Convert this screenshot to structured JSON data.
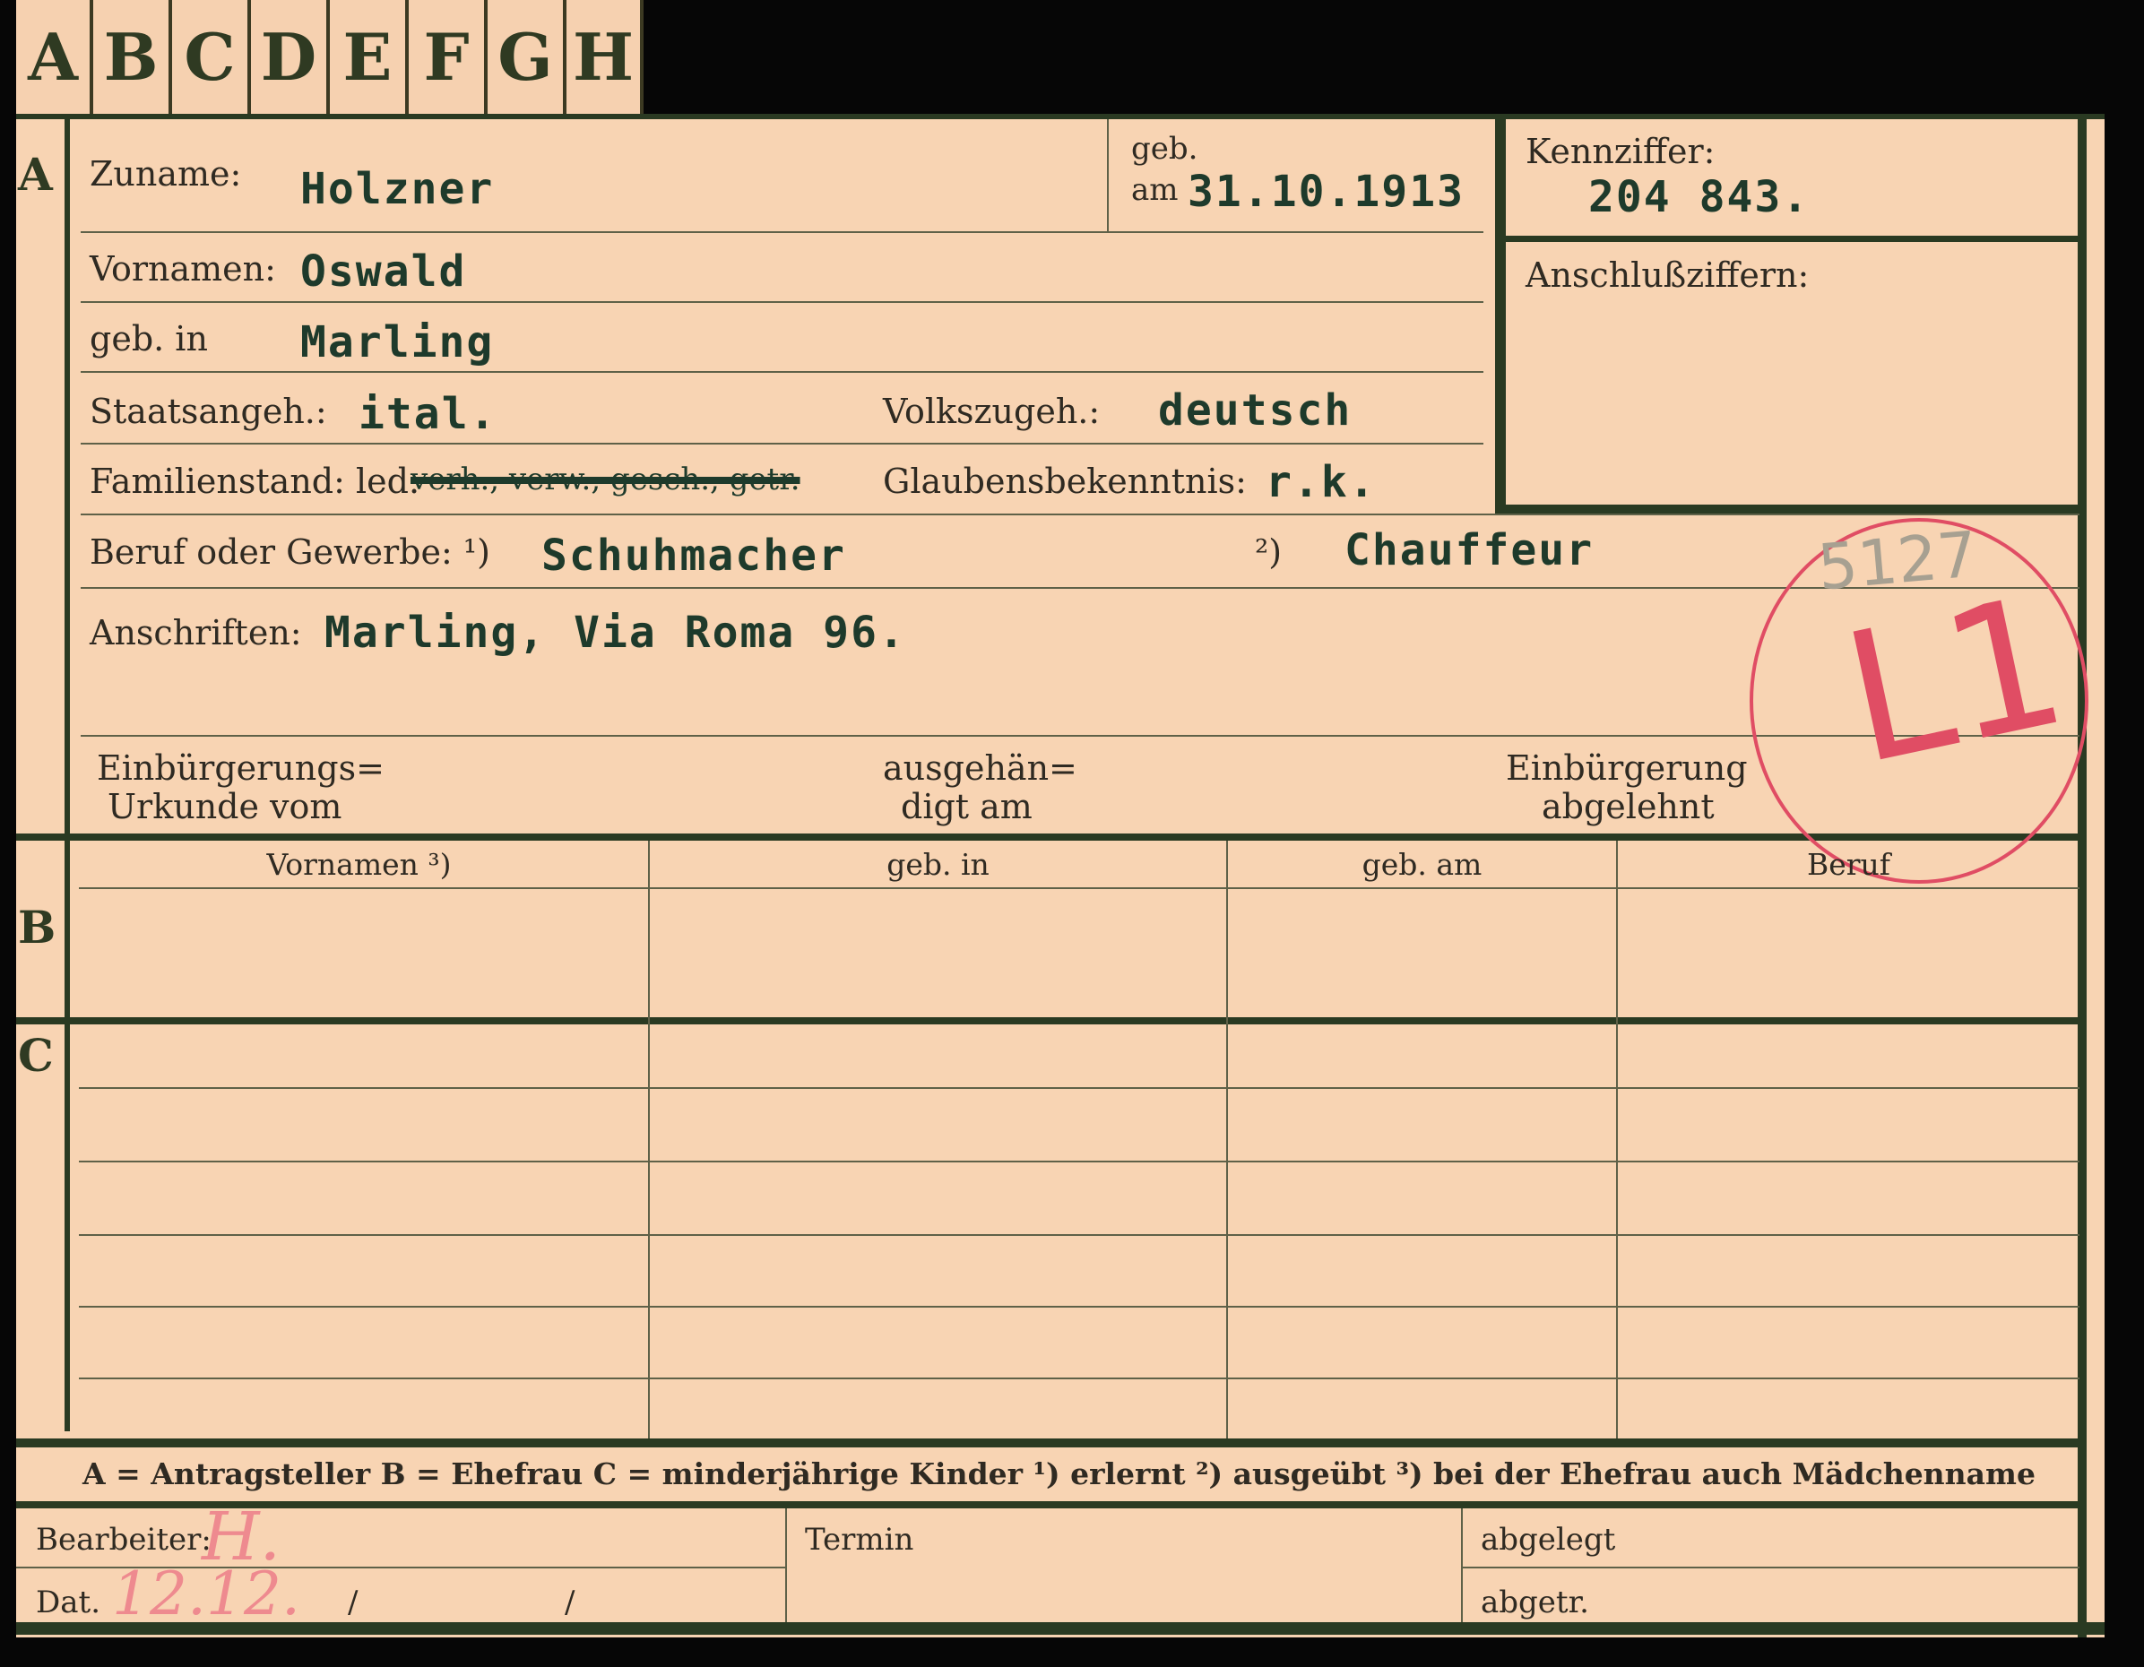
{
  "tabs": [
    "A",
    "B",
    "C",
    "D",
    "E",
    "F",
    "G",
    "H"
  ],
  "section_letters": {
    "a": "A",
    "b": "B",
    "c": "C"
  },
  "fields": {
    "zuname_label": "Zuname:",
    "zuname_value": "Holzner",
    "geb_label_top": "geb.",
    "geb_label_am": "am",
    "geb_value": "31.10.1913",
    "kennziffer_label": "Kennziffer:",
    "kennziffer_value": "204 843.",
    "anschluss_label": "Anschlußziffern:",
    "vornamen_label": "Vornamen:",
    "vornamen_value": "Oswald",
    "gebin_label": "geb. in",
    "gebin_value": "Marling",
    "staat_label": "Staatsangeh.:",
    "staat_value": "ital.",
    "volk_label": "Volkszugeh.:",
    "volk_value": "deutsch",
    "familien_label": "Familienstand: led.",
    "familien_crossed": "verh., verw., gesch., getr.",
    "glauben_label": "Glaubensbekenntnis:",
    "glauben_value": "r.k.",
    "beruf_label": "Beruf oder Gewerbe: ¹)",
    "beruf_value1": "Schuhmacher",
    "beruf_mark2": "²)",
    "beruf_value2": "Chauffeur",
    "anschrift_label": "Anschriften:",
    "anschrift_value": "Marling, Via Roma 96.",
    "einb_urkunde_1": "Einbürgerungs=",
    "einb_urkunde_2": "Urkunde vom",
    "ausgeh_1": "ausgehän=",
    "ausgeh_2": "digt am",
    "abgelehnt_1": "Einbürgerung",
    "abgelehnt_2": "abgelehnt"
  },
  "stamp": {
    "number": "5127",
    "code": "L1"
  },
  "table_headers": [
    "Vornamen ³)",
    "geb. in",
    "geb. am",
    "Beruf"
  ],
  "legend": "A = Antragsteller   B = Ehefrau   C = minderjährige Kinder   ¹) erlernt   ²) ausgeübt   ³) bei der Ehefrau auch Mädchenname",
  "footer": {
    "bearbeiter_label": "Bearbeiter:",
    "bearbeiter_sig": "H.",
    "termin_label": "Termin",
    "abgelegt_label": "abgelegt",
    "dat_label": "Dat.",
    "dat_value": "12.12.",
    "dat_sep1": "/",
    "dat_sep2": "/",
    "abgetr_label": "abgetr."
  },
  "colors": {
    "paper": "#f8d4b3",
    "ink": "#1e3a2b",
    "stamp": "#e04d64",
    "frame": "#2a3a22"
  }
}
